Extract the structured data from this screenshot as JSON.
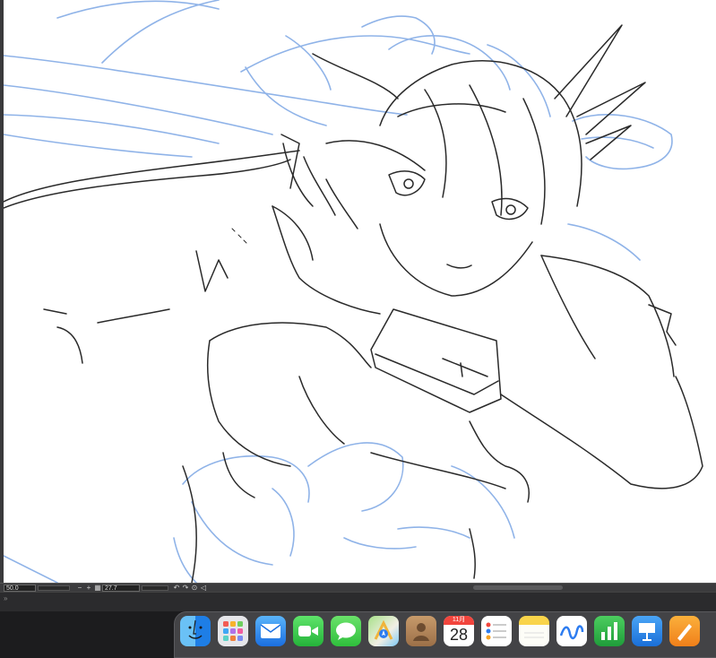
{
  "canvas": {
    "background": "#ffffff",
    "line_color": "#2a2a2a",
    "sketch_color": "#8fb3e8"
  },
  "status_bar": {
    "zoom": "50.0",
    "rotation": "27.7",
    "zoom_out_symbol": "−",
    "zoom_in_symbol": "+",
    "rotate_left_symbol": "↶",
    "rotate_right_symbol": "↷",
    "reset_symbol": "⊙"
  },
  "panel_strip": {
    "toggle_symbol": "»"
  },
  "dock": {
    "calendar_month": "11月",
    "calendar_day": "28",
    "apps": [
      {
        "name": "Finder",
        "icon": "finder-icon"
      },
      {
        "name": "Launchpad",
        "icon": "launchpad-icon"
      },
      {
        "name": "Mail",
        "icon": "mail-icon"
      },
      {
        "name": "FaceTime",
        "icon": "facetime-icon"
      },
      {
        "name": "Messages",
        "icon": "messages-icon"
      },
      {
        "name": "Maps",
        "icon": "maps-icon"
      },
      {
        "name": "Contacts",
        "icon": "contacts-icon"
      },
      {
        "name": "Calendar",
        "icon": "calendar-icon"
      },
      {
        "name": "Reminders",
        "icon": "reminders-icon"
      },
      {
        "name": "Notes",
        "icon": "notes-icon"
      },
      {
        "name": "Freeform",
        "icon": "freeform-icon"
      },
      {
        "name": "Numbers",
        "icon": "numbers-icon"
      },
      {
        "name": "Keynote",
        "icon": "keynote-icon"
      },
      {
        "name": "Pages",
        "icon": "pages-icon"
      }
    ]
  }
}
